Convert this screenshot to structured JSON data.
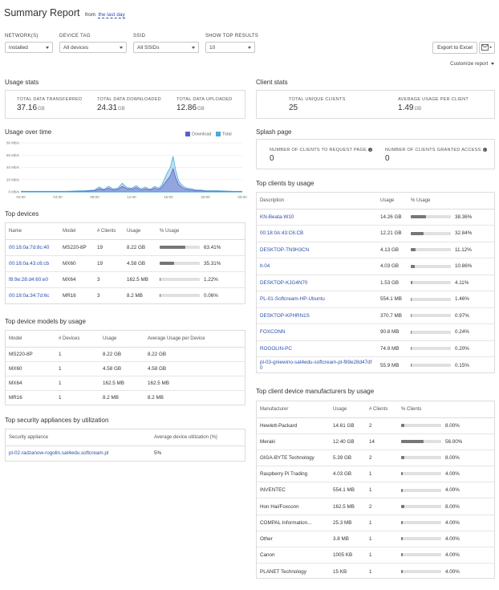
{
  "header": {
    "title": "Summary Report",
    "from": "from",
    "range": "the last day"
  },
  "filters": {
    "network": {
      "label": "NETWORK(S)",
      "value": "installed"
    },
    "device_tag": {
      "label": "DEVICE TAG",
      "value": "All devices"
    },
    "ssid": {
      "label": "SSID",
      "value": "All SSIDs"
    },
    "top_results": {
      "label": "SHOW TOP RESULTS",
      "value": "10"
    }
  },
  "toolbar": {
    "export_label": "Export to Excel",
    "email_icon": "envelope-icon",
    "customize_label": "Customize report"
  },
  "usage_stats": {
    "title": "Usage stats",
    "items": [
      {
        "label": "TOTAL DATA TRANSFERRED",
        "value": "37.16",
        "unit": "GB"
      },
      {
        "label": "TOTAL DATA DOWNLOADED",
        "value": "24.31",
        "unit": "GB"
      },
      {
        "label": "TOTAL DATA UPLOADED",
        "value": "12.86",
        "unit": "GB"
      }
    ]
  },
  "client_stats": {
    "title": "Client stats",
    "items": [
      {
        "label": "TOTAL UNIQUE CLIENTS",
        "value": "25",
        "unit": ""
      },
      {
        "label": "AVERAGE USAGE PER CLIENT",
        "value": "1.49",
        "unit": "GB"
      }
    ]
  },
  "usage_over_time": {
    "title": "Usage over time",
    "legend": {
      "download": "Download",
      "total": "Total"
    },
    "colors": {
      "download": "#5b5fc7",
      "total": "#4aa9d6"
    }
  },
  "chart_data": {
    "type": "area",
    "title": "Usage over time",
    "xlabel": "",
    "ylabel": "",
    "x_tick_labels": [
      "00:00",
      "04:00",
      "08:00",
      "12:00",
      "16:00",
      "20:00",
      "00:00"
    ],
    "y_tick_labels": [
      "0 Mb/s",
      "20 Mb/s",
      "40 Mb/s",
      "60 Mb/s",
      "80 Mb/s"
    ],
    "ylim": [
      0,
      80
    ],
    "xlim": [
      0,
      24
    ],
    "grid": true,
    "legend_position": "top-right",
    "series": [
      {
        "name": "Total",
        "x": [
          0,
          1,
          2,
          3,
          4,
          5,
          6,
          7,
          8,
          8.5,
          9,
          9.5,
          10,
          10.5,
          11,
          11.5,
          12,
          12.5,
          13,
          13.5,
          14,
          14.5,
          15,
          15.3,
          15.6,
          15.9,
          16.2,
          16.5,
          16.8,
          17.1,
          17.4,
          17.7,
          18,
          18.5,
          19,
          19.5,
          20,
          21,
          22,
          23,
          24
        ],
        "values": [
          1,
          1,
          1,
          1,
          1,
          1,
          1.5,
          2,
          3,
          8,
          4,
          9,
          5,
          6,
          14,
          7,
          6,
          10,
          5,
          8,
          4,
          9,
          6,
          12,
          22,
          32,
          40,
          58,
          34,
          18,
          12,
          8,
          6,
          5,
          3,
          3,
          2,
          2,
          1.5,
          1,
          1
        ]
      },
      {
        "name": "Download",
        "x": [
          0,
          1,
          2,
          3,
          4,
          5,
          6,
          7,
          8,
          8.5,
          9,
          9.5,
          10,
          10.5,
          11,
          11.5,
          12,
          12.5,
          13,
          13.5,
          14,
          14.5,
          15,
          15.3,
          15.6,
          15.9,
          16.2,
          16.5,
          16.8,
          17.1,
          17.4,
          17.7,
          18,
          18.5,
          19,
          19.5,
          20,
          21,
          22,
          23,
          24
        ],
        "values": [
          0.5,
          0.5,
          0.5,
          0.5,
          0.5,
          0.5,
          1,
          1,
          2,
          5,
          3,
          6,
          3,
          4,
          9,
          5,
          4,
          7,
          3,
          5,
          3,
          6,
          4,
          8,
          14,
          20,
          26,
          38,
          22,
          12,
          8,
          5,
          4,
          3,
          2,
          2,
          1,
          1,
          1,
          0.5,
          0.5
        ]
      }
    ]
  },
  "splash_page": {
    "title": "Splash page",
    "items": [
      {
        "label": "NUMBER OF CLIENTS TO REQUEST PAGE",
        "value": "0"
      },
      {
        "label": "NUMBER OF CLIENTS GRANTED ACCESS",
        "value": "0"
      }
    ]
  },
  "top_devices": {
    "title": "Top devices",
    "columns": [
      "Name",
      "Model",
      "# Clients",
      "Usage",
      "% Usage"
    ],
    "rows": [
      {
        "name": "00:18:0a:7d:8c:40",
        "model": "MS220-8P",
        "clients": "19",
        "usage": "8.22 GB",
        "pct": "63.41%",
        "pct_value": 63.41
      },
      {
        "name": "00:18:0a:43:c6:cb",
        "model": "MX60",
        "clients": "19",
        "usage": "4.58 GB",
        "pct": "35.31%",
        "pct_value": 35.31
      },
      {
        "name": "f8:9e:28:d4:60:e0",
        "model": "MX64",
        "clients": "3",
        "usage": "162.5 MB",
        "pct": "1.22%",
        "pct_value": 1.22
      },
      {
        "name": "00:18:0a:34:7d:6c",
        "model": "MR16",
        "clients": "3",
        "usage": "8.2 MB",
        "pct": "0.06%",
        "pct_value": 0.06
      }
    ]
  },
  "top_models": {
    "title": "Top device models by usage",
    "columns": [
      "Model",
      "# Devices",
      "Usage",
      "Average Usage per Device"
    ],
    "rows": [
      {
        "model": "MS220-8P",
        "devices": "1",
        "usage": "8.22 GB",
        "avg": "8.22 GB"
      },
      {
        "model": "MX60",
        "devices": "1",
        "usage": "4.58 GB",
        "avg": "4.58 GB"
      },
      {
        "model": "MX64",
        "devices": "1",
        "usage": "162.5 MB",
        "avg": "162.5 MB"
      },
      {
        "model": "MR16",
        "devices": "1",
        "usage": "8.2 MB",
        "avg": "8.2 MB"
      }
    ]
  },
  "top_security": {
    "title": "Top security appliances by utilization",
    "columns": [
      "Security appliance",
      "Average device utilization (%)"
    ],
    "rows": [
      {
        "name": "pl-02.radzanow-rogolin.sat4edu.softcream.pl",
        "util": "5%"
      }
    ]
  },
  "top_clients": {
    "title": "Top clients by usage",
    "columns": [
      "Description",
      "Usage",
      "% Usage"
    ],
    "rows": [
      {
        "desc": "KN-Beata-W10",
        "usage": "14.26 GB",
        "pct": "38.36%",
        "pct_value": 38.36
      },
      {
        "desc": "00:18:0A:43:C6:CB",
        "usage": "12.21 GB",
        "pct": "32.84%",
        "pct_value": 32.84
      },
      {
        "desc": "DESKTOP-TN9H3CN",
        "usage": "4.13 GB",
        "pct": "11.12%",
        "pct_value": 11.12
      },
      {
        "desc": "lt-04",
        "usage": "4.03 GB",
        "pct": "10.86%",
        "pct_value": 10.86
      },
      {
        "desc": "DESKTOP-KJG4N70",
        "usage": "1.53 GB",
        "pct": "4.11%",
        "pct_value": 4.11
      },
      {
        "desc": "PL-01-Softcream-HP-Ubuntu",
        "usage": "554.1 MB",
        "pct": "1.46%",
        "pct_value": 1.46
      },
      {
        "desc": "DESKTOP-KPHRN1S",
        "usage": "370.7 MB",
        "pct": "0.97%",
        "pct_value": 0.97
      },
      {
        "desc": "FOXCONN",
        "usage": "90.8 MB",
        "pct": "0.24%",
        "pct_value": 0.24
      },
      {
        "desc": "ROGOLIN-PC",
        "usage": "74.9 MB",
        "pct": "0.20%",
        "pct_value": 0.2
      },
      {
        "desc": "pl-03-gniewino-sat4edu-softcream-pl-f89e28d47df0",
        "usage": "55.9 MB",
        "pct": "0.15%",
        "pct_value": 0.15
      }
    ]
  },
  "top_manufacturers": {
    "title": "Top client device manufacturers by usage",
    "columns": [
      "Manufacturer",
      "Usage",
      "# Clients",
      "% Clients"
    ],
    "rows": [
      {
        "name": "Hewlett-Packard",
        "usage": "14.61 GB",
        "clients": "2",
        "pct": "8.00%",
        "pct_value": 8
      },
      {
        "name": "Meraki",
        "usage": "12.40 GB",
        "clients": "14",
        "pct": "56.00%",
        "pct_value": 56
      },
      {
        "name": "GIGA-BYTE Technology",
        "usage": "5.39 GB",
        "clients": "2",
        "pct": "8.00%",
        "pct_value": 8
      },
      {
        "name": "Raspberry Pi Trading",
        "usage": "4.03 GB",
        "clients": "1",
        "pct": "4.00%",
        "pct_value": 4
      },
      {
        "name": "INVENTEC",
        "usage": "554.1 MB",
        "clients": "1",
        "pct": "4.00%",
        "pct_value": 4
      },
      {
        "name": "Hon Hai/Foxconn",
        "usage": "162.5 MB",
        "clients": "2",
        "pct": "8.00%",
        "pct_value": 8
      },
      {
        "name": "COMPAL Information...",
        "usage": "25.3 MB",
        "clients": "1",
        "pct": "4.00%",
        "pct_value": 4
      },
      {
        "name": "Other",
        "usage": "3.8 MB",
        "clients": "1",
        "pct": "4.00%",
        "pct_value": 4
      },
      {
        "name": "Canon",
        "usage": "1005 KB",
        "clients": "1",
        "pct": "4.00%",
        "pct_value": 4
      },
      {
        "name": "PLANET Technology",
        "usage": "15 KB",
        "clients": "1",
        "pct": "4.00%",
        "pct_value": 4
      }
    ]
  }
}
